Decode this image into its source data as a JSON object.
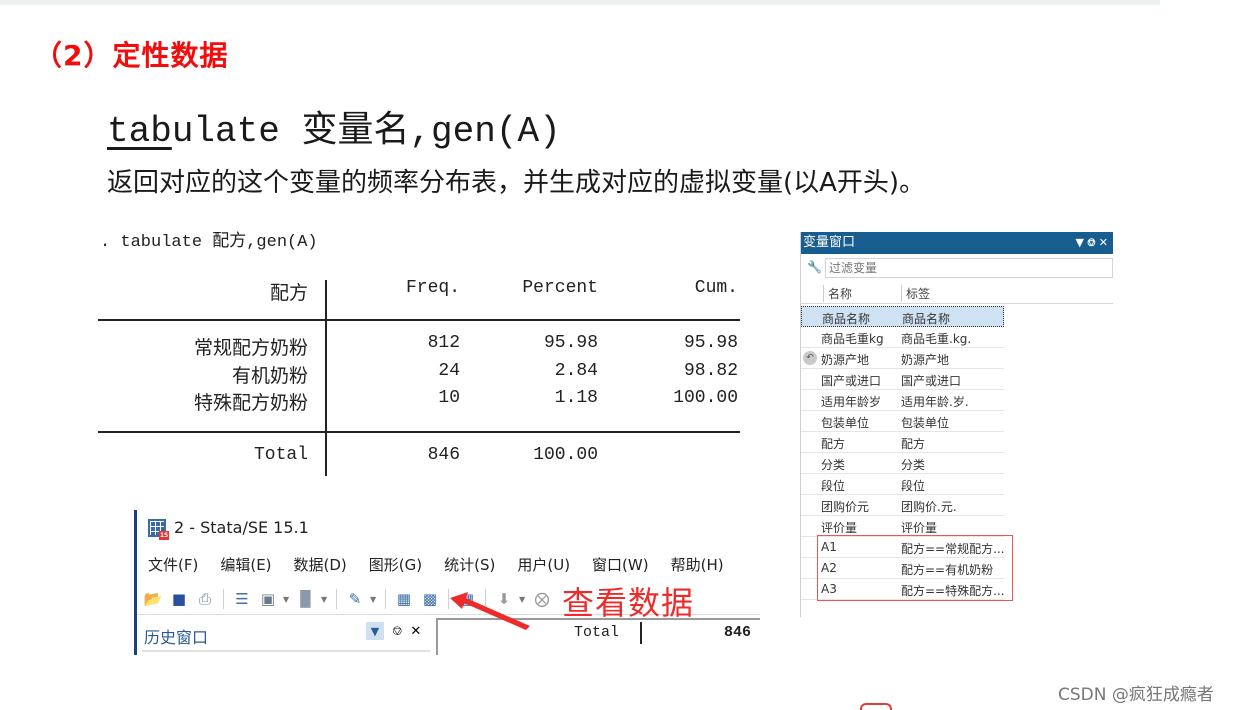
{
  "section": {
    "title": "（2）定性数据"
  },
  "command": {
    "prefix_underlined": "tab",
    "prefix_rest": "ulate ",
    "varname": "变量名",
    "suffix": ",gen(A)",
    "description": "返回对应的这个变量的频率分布表，并生成对应的虚拟变量(以A开头)。"
  },
  "stata_output": {
    "command_line": ". tabulate 配方,gen(A)",
    "headers": [
      "配方",
      "Freq.",
      "Percent",
      "Cum."
    ],
    "rows": [
      {
        "label": "常规配方奶粉",
        "freq": "812",
        "percent": "95.98",
        "cum": "95.98"
      },
      {
        "label": "有机奶粉",
        "freq": "24",
        "percent": "2.84",
        "cum": "98.82"
      },
      {
        "label": "特殊配方奶粉",
        "freq": "10",
        "percent": "1.18",
        "cum": "100.00"
      }
    ],
    "total": {
      "label": "Total",
      "freq": "846",
      "percent": "100.00"
    }
  },
  "stata_window": {
    "title": "2 - Stata/SE 15.1",
    "app_badge": "15",
    "menus": [
      "文件(F)",
      "编辑(E)",
      "数据(D)",
      "图形(G)",
      "统计(S)",
      "用户(U)",
      "窗口(W)",
      "帮助(H)"
    ],
    "toolbar_icons": [
      "open-icon",
      "save-icon",
      "print-icon",
      "log-icon",
      "viewer-icon",
      "graph-icon",
      "do-file-editor-icon",
      "data-editor-icon",
      "data-browser-icon",
      "variables-manager-icon",
      "more-icon",
      "break-icon"
    ],
    "annotation": "查看数据",
    "history_title": "历史窗口",
    "results_total_label": "Total",
    "results_total_value": "846"
  },
  "variable_window": {
    "title": "变量窗口",
    "filter_placeholder": "过滤变量",
    "col_name": "名称",
    "col_label": "标签",
    "rows": [
      {
        "name": "商品名称",
        "label": "商品名称"
      },
      {
        "name": "商品毛重kg",
        "label": "商品毛重.kg."
      },
      {
        "name": "奶源产地",
        "label": "奶源产地"
      },
      {
        "name": "国产或进口",
        "label": "国产或进口"
      },
      {
        "name": "适用年龄岁",
        "label": "适用年龄.岁."
      },
      {
        "name": "包装单位",
        "label": "包装单位"
      },
      {
        "name": "配方",
        "label": "配方"
      },
      {
        "name": "分类",
        "label": "分类"
      },
      {
        "name": "段位",
        "label": "段位"
      },
      {
        "name": "团购价元",
        "label": "团购价.元."
      },
      {
        "name": "评价量",
        "label": "评价量"
      },
      {
        "name": "A1",
        "label": "配方==常规配方..."
      },
      {
        "name": "A2",
        "label": "配方==有机奶粉"
      },
      {
        "name": "A3",
        "label": "配方==特殊配方..."
      }
    ]
  },
  "watermark": "CSDN @疯狂成瘾者",
  "colors": {
    "title_red": "#f20c0c",
    "var_header_blue": "#185d8f",
    "annotation_red": "#ee2b2b"
  }
}
